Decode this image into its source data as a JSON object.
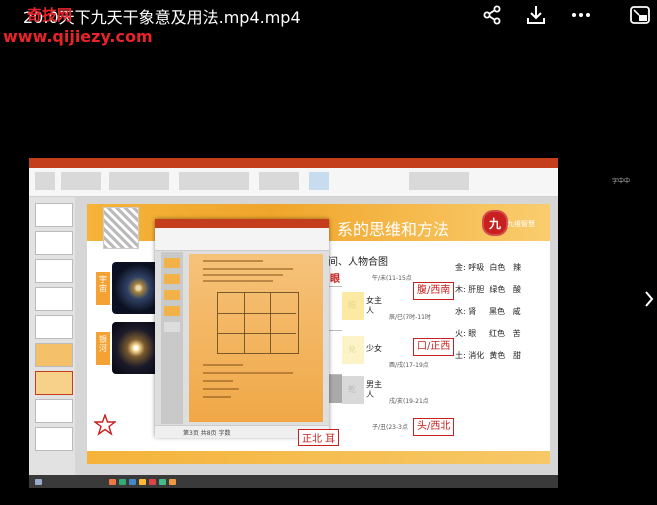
{
  "header": {
    "title": "20.0天下九天干象意及用法.mp4.mp4",
    "watermark_name": "奇技网",
    "watermark_url": "www.qijiezy.com"
  },
  "toolbar": {
    "share_icon": "share-icon",
    "download_icon": "download-icon",
    "more_icon": "more-icon",
    "pip_icon": "picture-in-picture-icon"
  },
  "side_note": "字中中",
  "slide": {
    "header_title": "系的思维和方法",
    "logo_char": "九",
    "brand": "九维智慧",
    "sub_heading": "间、人物合图",
    "eye_label": "眼",
    "arrow_left_top": "宇宙",
    "arrow_left_bottom": "银河",
    "rows": [
      {
        "text": "女主人",
        "time": "辰/巳(7时-11时",
        "box": "腹/西南",
        "light": "阳"
      },
      {
        "text": "少女",
        "time": "酉/戌(17-19点",
        "box": "口/正西",
        "light": "兑"
      },
      {
        "text": "男主人",
        "time": "戌/亥(19-21点",
        "box": "头/西北",
        "light": "乾"
      }
    ],
    "top_time": "午/未(11-15点",
    "bottom_time": "子/丑(23-3点",
    "ear_label": "正北 耳",
    "elements": [
      {
        "element": "金:",
        "organ": "呼吸",
        "color": "白色",
        "taste": "辣"
      },
      {
        "element": "木:",
        "organ": "肝胆",
        "color": "绿色",
        "taste": "酸"
      },
      {
        "element": "水:",
        "organ": "肾",
        "color": "黑色",
        "taste": "咸"
      },
      {
        "element": "火:",
        "organ": "眼",
        "color": "红色",
        "taste": "苦"
      },
      {
        "element": "土:",
        "organ": "消化",
        "color": "黄色",
        "taste": "甜"
      }
    ]
  },
  "word_window": {
    "status_text": "第3页 共8页 字数"
  },
  "colors": {
    "accent_red": "#c8201e",
    "ppt_orange": "#c43e1c",
    "slide_gold": "#f5b33a"
  }
}
